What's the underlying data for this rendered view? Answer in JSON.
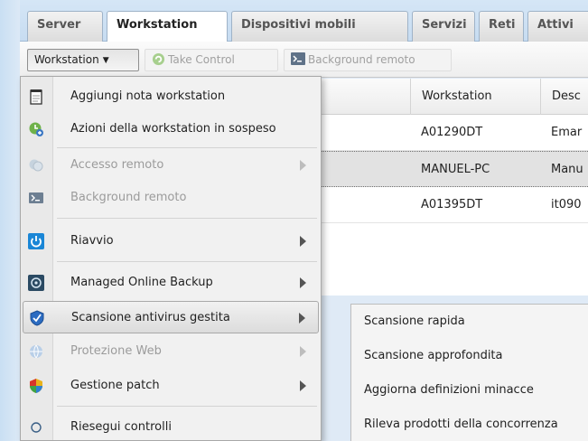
{
  "tabs": [
    {
      "label": "Server",
      "active": false
    },
    {
      "label": "Workstation",
      "active": true
    },
    {
      "label": "Dispositivi mobili",
      "active": false
    },
    {
      "label": "Servizi",
      "active": false
    },
    {
      "label": "Reti",
      "active": false
    },
    {
      "label": "Attivi",
      "active": false
    }
  ],
  "toolbar": {
    "workstation_label": "Workstation",
    "take_control_label": "Take Control",
    "background_label": "Background remoto"
  },
  "grid": {
    "columns": [
      "Workstation",
      "Desc"
    ],
    "rows": [
      {
        "workstation": "A01290DT",
        "desc": "Emar",
        "selected": false
      },
      {
        "workstation": "MANUEL-PC",
        "desc": "Manu",
        "selected": true
      },
      {
        "workstation": "A01395DT",
        "desc": "it090",
        "selected": false
      }
    ]
  },
  "menu": {
    "items": [
      {
        "label": "Aggiungi nota workstation",
        "icon": "notepad-icon",
        "disabled": false,
        "submenu": false
      },
      {
        "label": "Azioni della workstation in sospeso",
        "icon": "pending-actions-icon",
        "disabled": false,
        "submenu": false
      },
      {
        "label": "Accesso remoto",
        "icon": "remote-access-icon",
        "disabled": true,
        "submenu": true
      },
      {
        "label": "Background remoto",
        "icon": "terminal-icon",
        "disabled": true,
        "submenu": false
      },
      {
        "label": "Riavvio",
        "icon": "power-icon",
        "disabled": false,
        "submenu": true
      },
      {
        "label": "Managed Online Backup",
        "icon": "backup-icon",
        "disabled": false,
        "submenu": true
      },
      {
        "label": "Scansione antivirus gestita",
        "icon": "shield-icon",
        "disabled": false,
        "submenu": true
      },
      {
        "label": "Protezione Web",
        "icon": "web-protection-icon",
        "disabled": true,
        "submenu": true
      },
      {
        "label": "Gestione patch",
        "icon": "patch-shield-icon",
        "disabled": false,
        "submenu": true
      },
      {
        "label": "Riesegui controlli",
        "icon": "circle-icon",
        "disabled": false,
        "submenu": false
      }
    ]
  },
  "submenu": {
    "items": [
      "Scansione rapida",
      "Scansione approfondita",
      "Aggiorna definizioni minacce",
      "Rileva prodotti della concorrenza"
    ]
  },
  "colors": {
    "accent_blue": "#2f7fd2",
    "tab_border": "#9fb3c8",
    "disabled_text": "#9b9b9b"
  }
}
